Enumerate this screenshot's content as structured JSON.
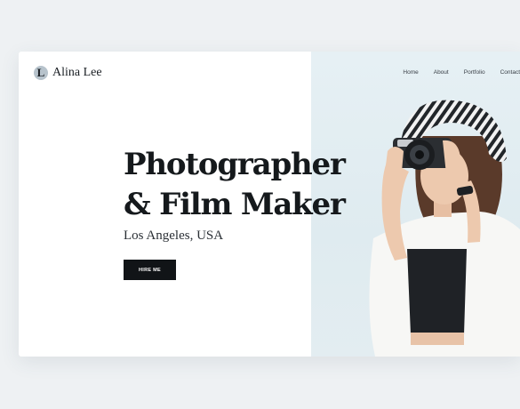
{
  "brand": {
    "initial": "L",
    "name": "Alina Lee"
  },
  "nav": {
    "items": [
      "Home",
      "About",
      "Portfolio",
      "Contact"
    ]
  },
  "hero": {
    "title_line1": "Photographer",
    "title_line2": "& Film Maker",
    "location": "Los Angeles, USA",
    "cta_label": "HIRE ME"
  },
  "colors": {
    "background": "#eef1f3",
    "card": "#ffffff",
    "photo_bg": "#e3edf1",
    "text_dark": "#15191c",
    "button": "#111417"
  }
}
